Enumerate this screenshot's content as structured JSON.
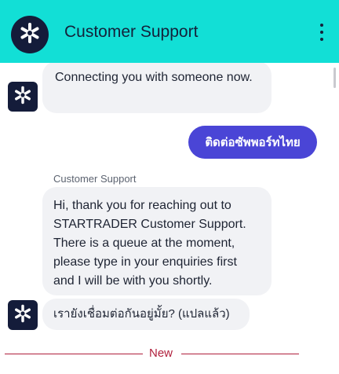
{
  "header": {
    "title": "Customer Support"
  },
  "messages": {
    "connecting": "Connecting you with someone now.",
    "user_message": "ติดต่อซัพพอร์ทไทย",
    "sender_name": "Customer Support",
    "agent_greeting": "Hi, thank you for reaching out to STARTRADER Customer Support. There is a queue at the moment, please type in your enquiries first and I will be with you shortly.",
    "agent_translated": "เรายังเชื่อมต่อกันอยู่มั้ย? (แปลแล้ว)"
  },
  "divider": {
    "label": "New"
  },
  "colors": {
    "header_bg": "#12dfd6",
    "user_bubble": "#4a45d6",
    "agent_bubble": "#f1f2f5",
    "avatar_bg": "#141c3a",
    "new_divider": "#b01f3c"
  },
  "icons": {
    "brand": "star-asterisk-icon",
    "menu": "more-vertical-icon"
  }
}
